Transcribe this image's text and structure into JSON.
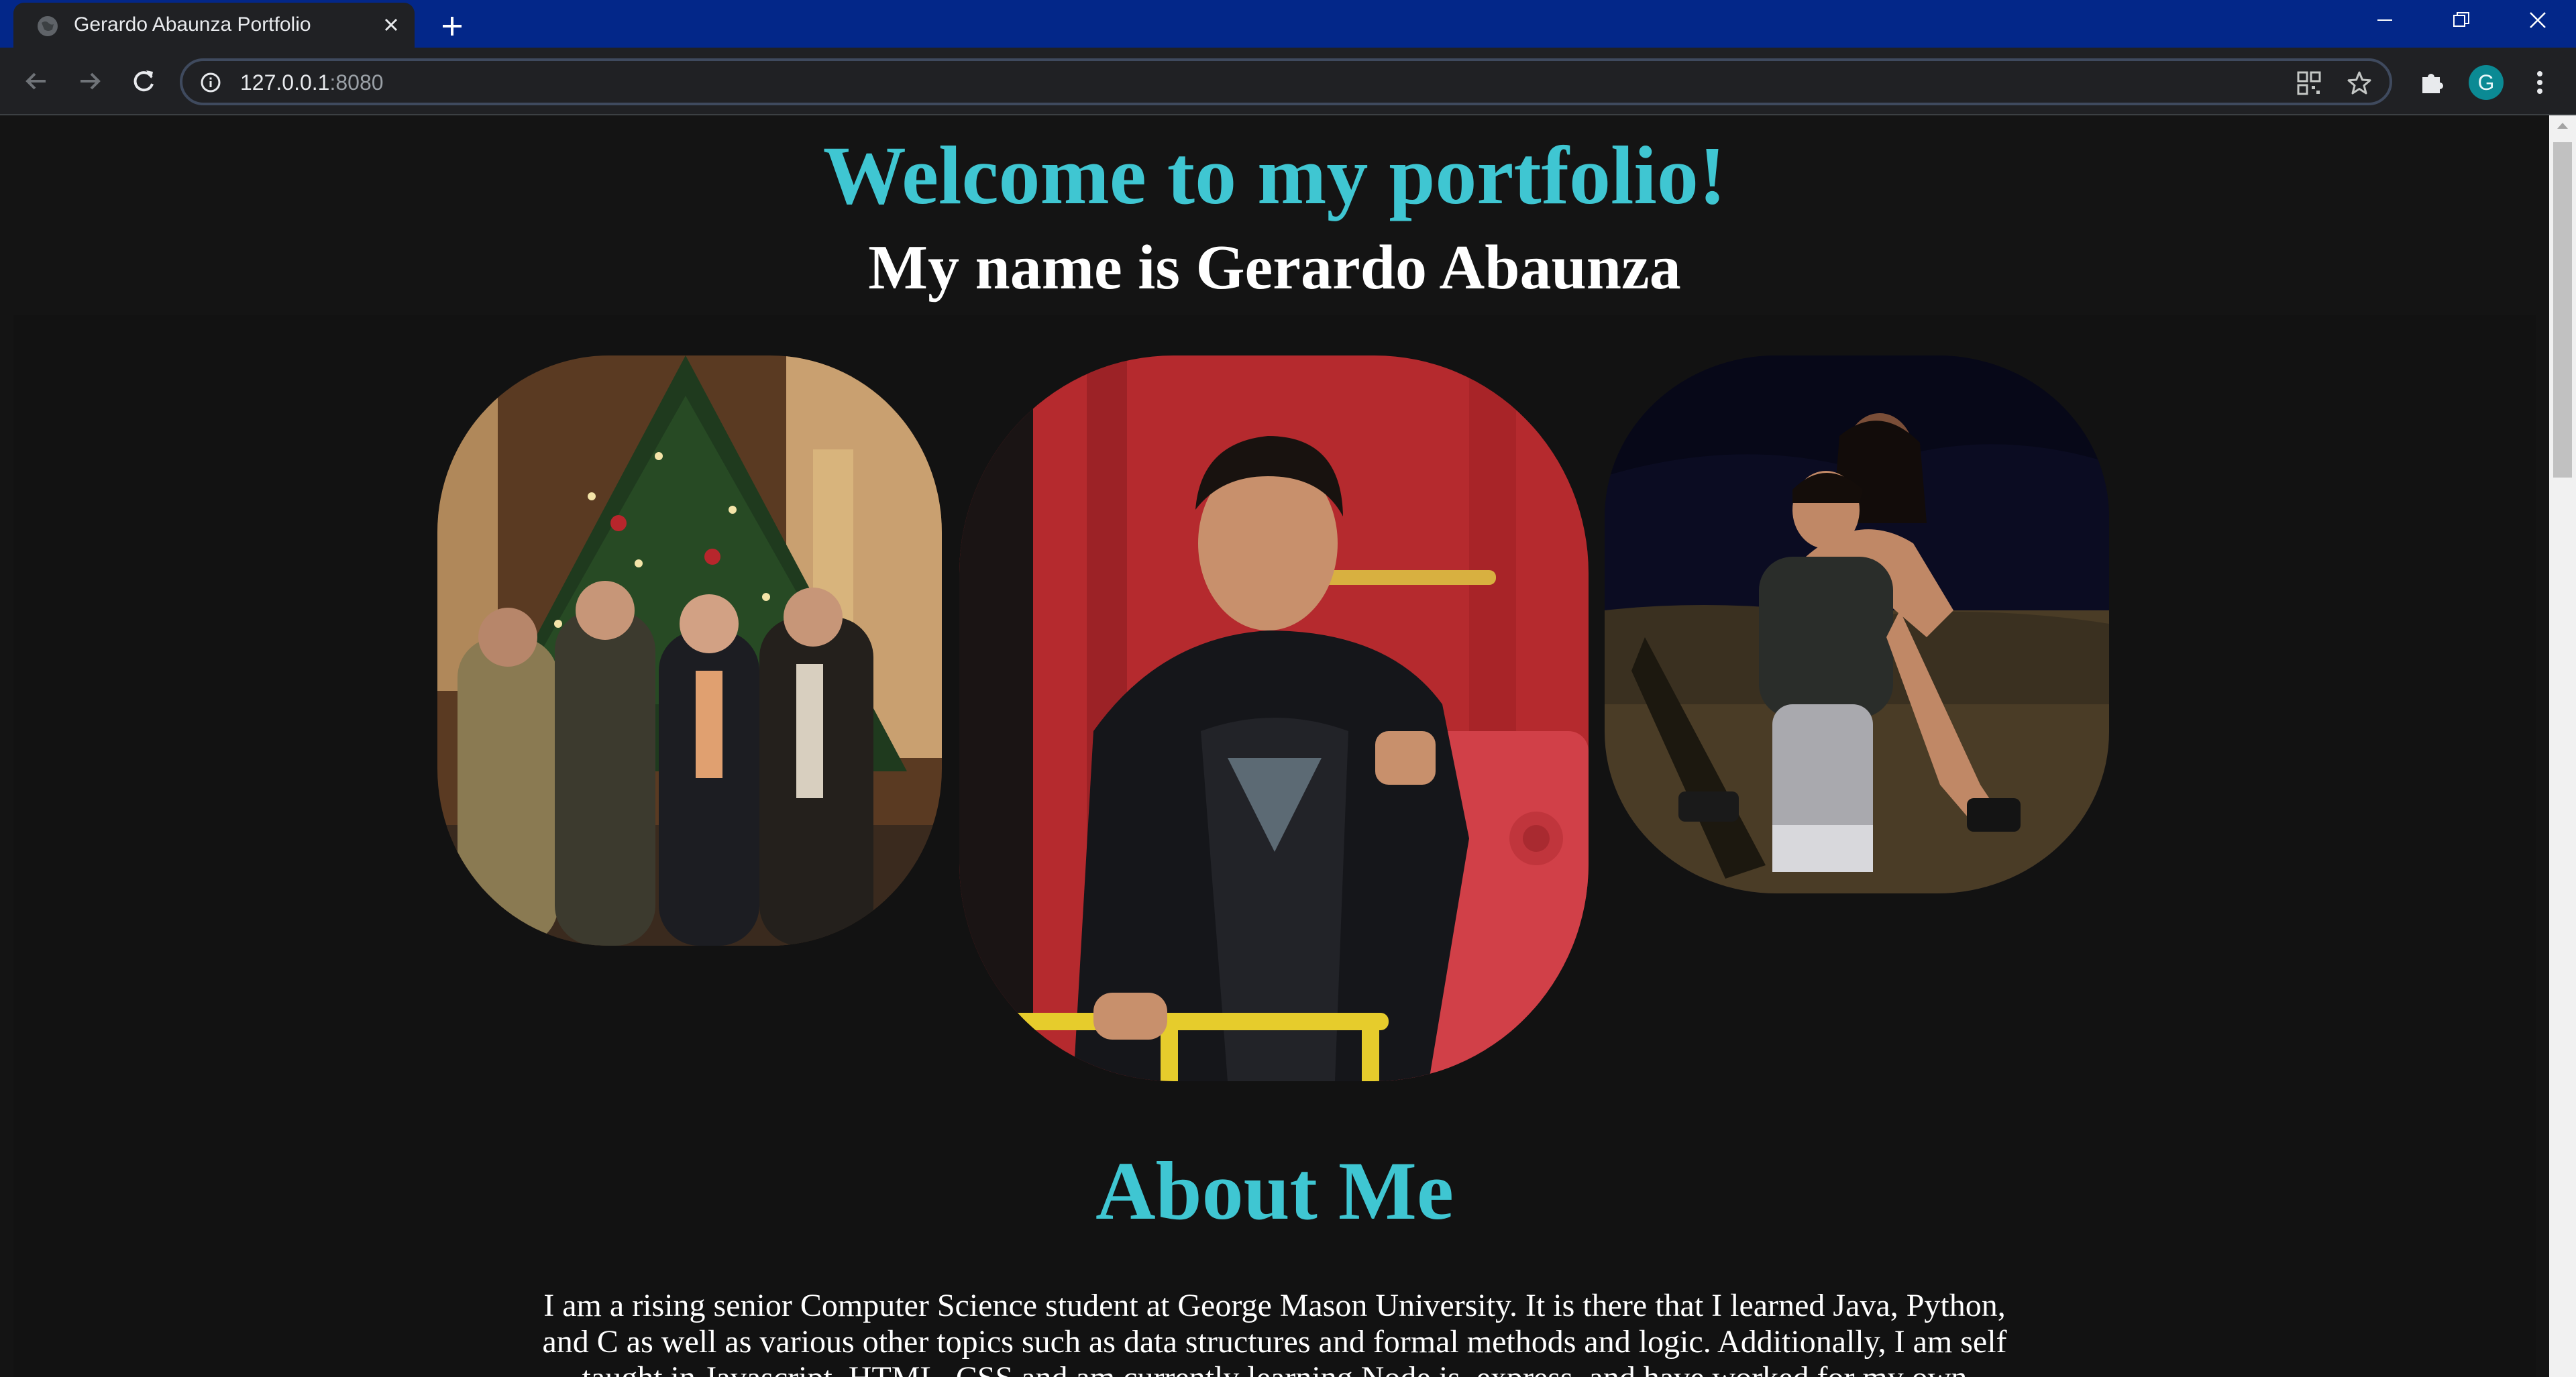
{
  "browser": {
    "tab_title": "Gerardo Abaunza Portfolio",
    "url_host": "127.0.0.1",
    "url_port": ":8080",
    "avatar_letter": "G",
    "accent_color": "#032789"
  },
  "page": {
    "title": "Welcome to my portfolio!",
    "subtitle": "My name is Gerardo Abaunza",
    "photos": [
      {
        "subject": "group-photo-christmas-tree"
      },
      {
        "subject": "portrait-red-train"
      },
      {
        "subject": "piggyback-photo-night"
      }
    ],
    "about_heading": "About Me",
    "about_text": "I am a rising senior Computer Science student at George Mason University. It is there that I learned Java, Python, and C as well as various other topics such as data structures and formal methods and logic. Additionally, I am self taught in Javascript, HTML, CSS and am currently learning Node.js, express, and have worked for my own",
    "colors": {
      "heading": "#3fc6d2",
      "background": "#141414",
      "text": "#ffffff"
    }
  }
}
